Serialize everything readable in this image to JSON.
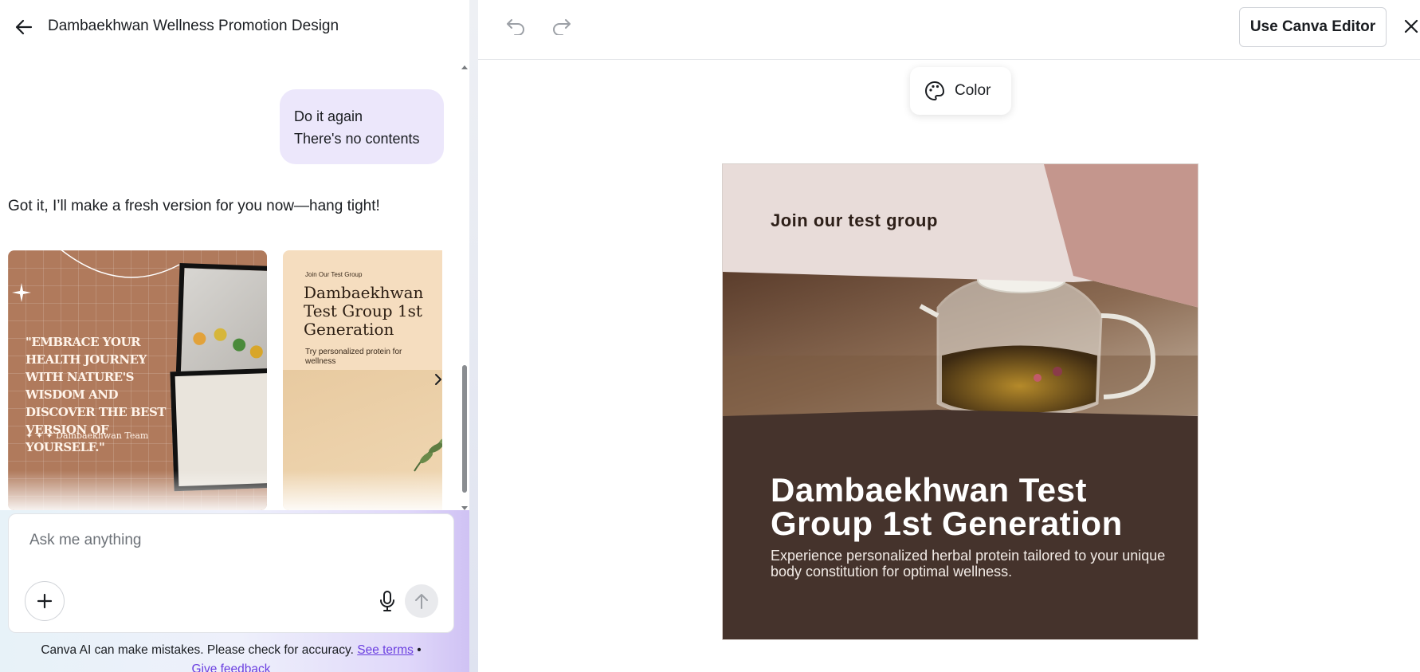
{
  "header": {
    "title": "Dambaekhwan Wellness Promotion Design"
  },
  "chat": {
    "user_message_line1": "Do it again",
    "user_message_line2": "There's no contents",
    "ai_reply": "Got it, I’ll make a fresh version for you now—hang tight!",
    "carousel": [
      {
        "quote": "\"EMBRACE YOUR HEALTH JOURNEY WITH NATURE'S WISDOM AND DISCOVER THE BEST VERSION OF YOURSELF.\"",
        "signature": "✦ ✦ ✦  Dambaekhwan Team"
      },
      {
        "eyebrow": "Join Our Test Group",
        "title": "Dambaekhwan Test Group 1st Generation",
        "subtitle": "Try personalized protein for wellness"
      }
    ]
  },
  "composer": {
    "placeholder": "Ask me anything"
  },
  "disclaimer": {
    "text": "Canva AI can make mistakes. Please check for accuracy.",
    "terms_link": "See terms",
    "separator": "•",
    "feedback_link": "Give feedback"
  },
  "toolbar": {
    "use_editor_label": "Use Canva Editor",
    "color_label": "Color"
  },
  "design": {
    "eyebrow": "Join our test group",
    "headline": "Dambaekhwan Test Group 1st Generation",
    "body": "Experience personalized herbal protein tailored to your unique body constitution for optimal wellness.",
    "colors": {
      "light": "#e8dcd9",
      "rose": "#c4968d",
      "brown": "#45332c"
    }
  },
  "icons": {
    "back": "arrow-left-icon",
    "undo": "undo-icon",
    "redo": "redo-icon",
    "close": "close-icon",
    "palette": "palette-icon",
    "add": "plus-icon",
    "mic": "microphone-icon",
    "send": "arrow-up-icon",
    "next": "chevron-right-icon"
  }
}
